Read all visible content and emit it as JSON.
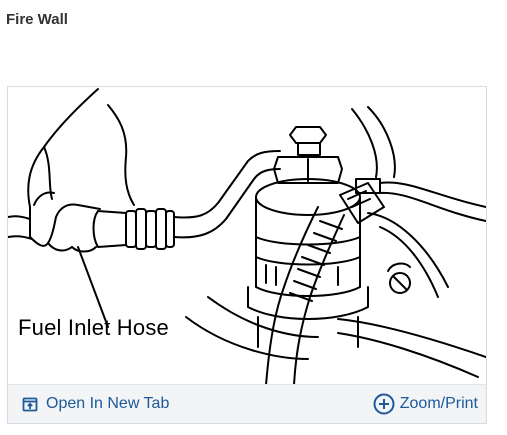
{
  "page": {
    "title": "Fire Wall"
  },
  "figure": {
    "callout_label": "Fuel Inlet Hose",
    "toolbar": {
      "open_new_tab_label": "Open In New Tab",
      "open_new_tab_icon": "open-in-new-tab-icon",
      "zoom_print_label": "Zoom/Print",
      "zoom_print_icon": "plus-circle-icon"
    }
  },
  "colors": {
    "link": "#1d5a9a",
    "title": "#333333",
    "toolbar_bg": "#f2f4f6",
    "border": "#d8dce0"
  }
}
